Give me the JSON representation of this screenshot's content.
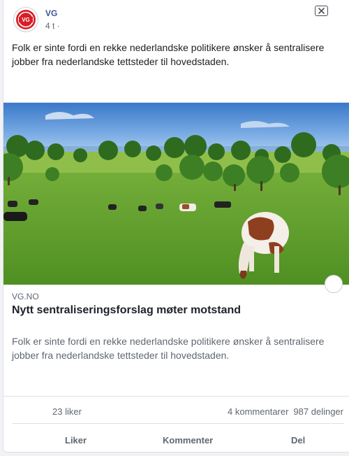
{
  "post": {
    "page_name": "VG",
    "time": "4 t ·",
    "text": "Folk er sinte fordi en rekke nederlandske politikere ønsker å sentralisere jobber fra nederlandske tettsteder til hovedstaden."
  },
  "link": {
    "domain": "VG.NO",
    "title": "Nytt sentraliseringsforslag møter motstand",
    "description": "Folk er sinte fordi en rekke nederlandske politikere ønsker å sentralisere jobber fra nederlandske tettsteder til hovedstaden."
  },
  "stats": {
    "likes": "23 liker",
    "comments": "4 kommentarer",
    "shares": "987 delinger"
  },
  "actions": {
    "like": "Liker",
    "comment": "Kommenter",
    "share": "Del"
  },
  "colors": {
    "brand_red": "#d81e27",
    "link_blue": "#385898"
  },
  "icons": {
    "avatar": "vg-logo",
    "close": "close-icon"
  }
}
